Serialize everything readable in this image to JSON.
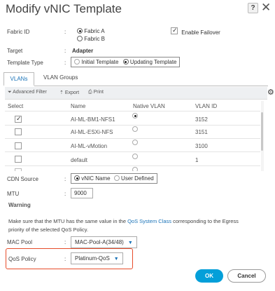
{
  "dialog": {
    "title": "Modify vNIC Template",
    "help_label": "?",
    "close_label": "✕"
  },
  "form": {
    "fabric_id": {
      "label": "Fabric ID",
      "options": [
        "Fabric A",
        "Fabric B"
      ],
      "selected": "Fabric A",
      "enable_failover_label": "Enable Failover",
      "enable_failover_checked": true
    },
    "target": {
      "label": "Target",
      "value": "Adapter"
    },
    "template_type": {
      "label": "Template Type",
      "options": [
        "Initial Template",
        "Updating Template"
      ],
      "selected": "Updating Template"
    }
  },
  "tabs": [
    {
      "label": "VLANs",
      "active": true
    },
    {
      "label": "VLAN Groups",
      "active": false
    }
  ],
  "toolbar": {
    "advanced_filter": "Advanced Filter",
    "export": "Export",
    "print": "Print"
  },
  "vlan_table": {
    "columns": [
      "Select",
      "Name",
      "Native VLAN",
      "VLAN ID"
    ],
    "rows": [
      {
        "selected": true,
        "name": "AI-ML-BM1-NFS1",
        "native": true,
        "vlan_id": "3152"
      },
      {
        "selected": false,
        "name": "AI-ML-ESXi-NFS",
        "native": false,
        "vlan_id": "3151"
      },
      {
        "selected": false,
        "name": "AI-ML-vMotion",
        "native": false,
        "vlan_id": "3100"
      },
      {
        "selected": false,
        "name": "default",
        "native": false,
        "vlan_id": "1"
      }
    ]
  },
  "cdn_source": {
    "label": "CDN Source",
    "options": [
      "vNIC Name",
      "User Defined"
    ],
    "selected": "vNIC Name"
  },
  "mtu": {
    "label": "MTU",
    "value": "9000"
  },
  "warning": {
    "title": "Warning",
    "text_before": "Make sure that the MTU has the same value in the ",
    "link": "QoS System Class",
    "text_after": " corresponding to the Egress priority of the selected QoS Policy."
  },
  "mac_pool": {
    "label": "MAC Pool",
    "value": "MAC-Pool-A(34/48)"
  },
  "qos_policy": {
    "label": "QoS Policy",
    "value": "Platinum-QoS"
  },
  "buttons": {
    "ok": "OK",
    "cancel": "Cancel"
  },
  "colors": {
    "accent": "#049fd9",
    "link": "#1a73b8",
    "highlight": "#e74c2a"
  }
}
